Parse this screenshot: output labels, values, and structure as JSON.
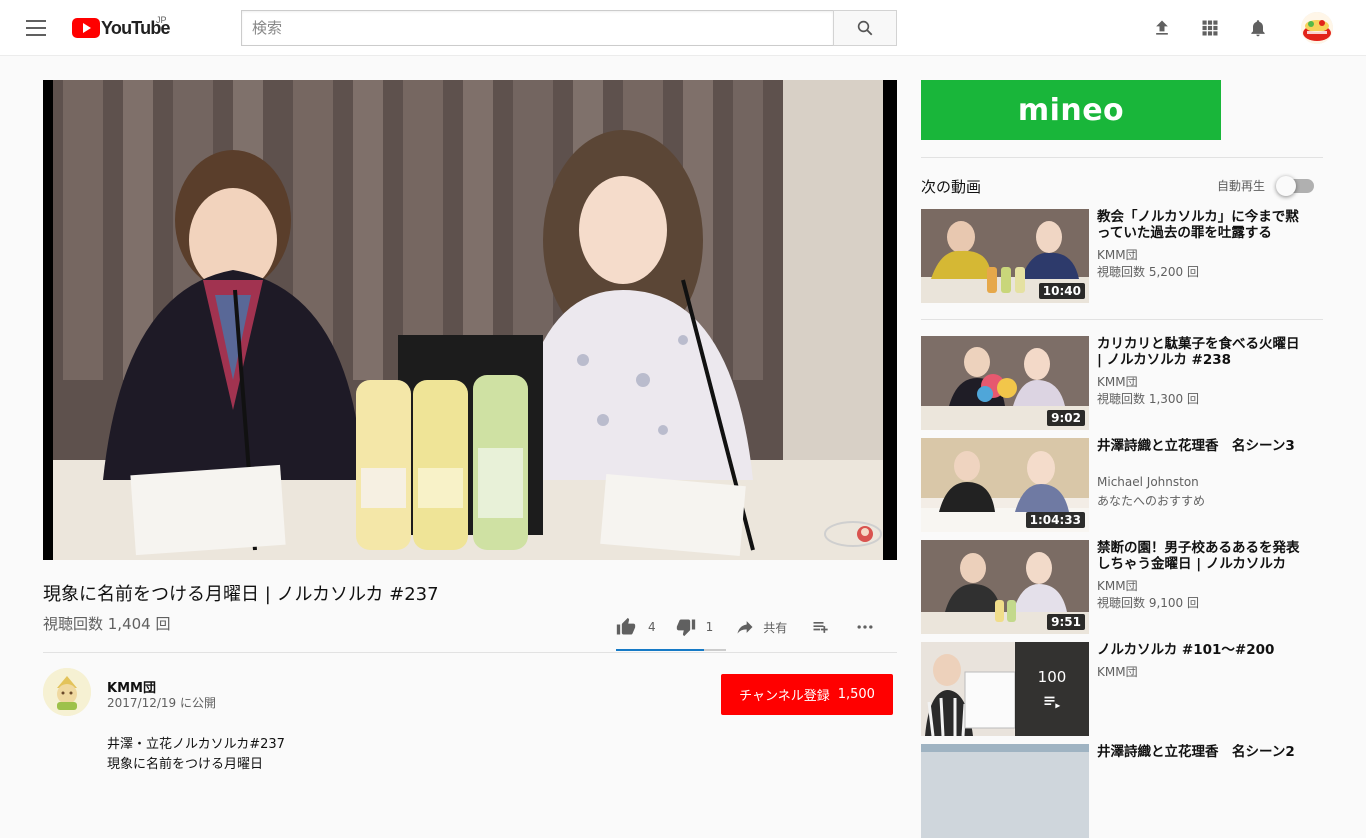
{
  "masthead": {
    "logo_text": "YouTube",
    "logo_region": "JP",
    "search_placeholder": "検索"
  },
  "video": {
    "title": "現象に名前をつける月曜日 | ノルカソルカ #237",
    "views": "視聴回数 1,404 回",
    "likes": "4",
    "dislikes": "1",
    "share_label": "共有",
    "like_ratio": 0.8
  },
  "owner": {
    "name": "KMM団",
    "published": "2017/12/19 に公開",
    "subscribe_label": "チャンネル登録",
    "subscriber_count": "1,500"
  },
  "description": {
    "lines": [
      "井澤・立花ノルカソルカ#237",
      "現象に名前をつける月曜日"
    ]
  },
  "ad": {
    "brand": "mineo"
  },
  "sidebar": {
    "up_next_label": "次の動画",
    "autoplay_label": "自動再生",
    "autoplay_on": false,
    "items": [
      {
        "title": "教会「ノルカソルカ」に今まで黙っていた過去の罪を吐露する",
        "channel": "KMM団",
        "views": "視聴回数 5,200 回",
        "duration": "10:40"
      },
      {
        "title": "カリカリと駄菓子を食べる火曜日 | ノルカソルカ #238",
        "channel": "KMM団",
        "views": "視聴回数 1,300 回",
        "duration": "9:02"
      },
      {
        "title": "井澤詩織と立花理香　名シーン3",
        "channel": "Michael Johnston",
        "views": "あなたへのおすすめ",
        "duration": "1:04:33"
      },
      {
        "title": "禁断の園！男子校あるあるを発表しちゃう金曜日 | ノルカソルカ",
        "channel": "KMM団",
        "views": "視聴回数 9,100 回",
        "duration": "9:51"
      },
      {
        "title": "ノルカソルカ #101〜#200",
        "channel": "KMM団",
        "playlist_count": "100"
      },
      {
        "title": "井澤詩織と立花理香　名シーン2"
      }
    ]
  },
  "colors": {
    "accent_red": "#ff0000",
    "link_blue": "#167ac6",
    "ad_green": "#19b63a"
  },
  "icons": [
    "menu-icon",
    "search-icon",
    "upload-icon",
    "apps-icon",
    "bell-icon",
    "thumb-up-icon",
    "thumb-down-icon",
    "share-icon",
    "add-to-playlist-icon",
    "more-icon",
    "playlist-icon"
  ]
}
